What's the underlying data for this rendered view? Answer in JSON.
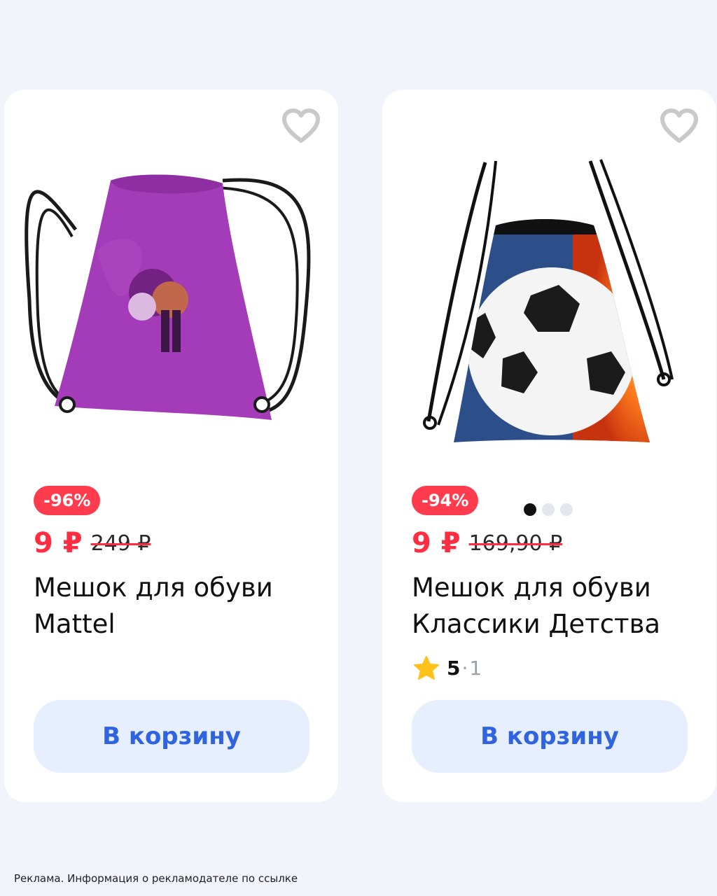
{
  "products": [
    {
      "discount": "-96%",
      "price": "9 ₽",
      "old_price": "249 ₽",
      "title_line1": "Мешок для обуви",
      "title_line2": "Mattel",
      "cart_label": "В корзину",
      "favorite_icon": "heart-outline-icon",
      "image": "purple-drawstring-bag"
    },
    {
      "discount": "-94%",
      "price": "9 ₽",
      "old_price": "169,90 ₽",
      "title_line1": "Мешок для обуви",
      "title_line2": "Классики Детства",
      "rating_value": "5",
      "rating_sep": "·",
      "rating_count": "1",
      "cart_label": "В корзину",
      "favorite_icon": "heart-outline-icon",
      "image": "football-fire-drawstring-bag",
      "carousel": {
        "count": 3,
        "active": 1
      }
    }
  ],
  "ad_note": "Реклама. Информация о рекламодателе по ссылке",
  "colors": {
    "background": "#f1f4fb",
    "accent_red": "#ff2d42",
    "button_bg": "#e7efff",
    "button_text": "#2f63e0"
  }
}
